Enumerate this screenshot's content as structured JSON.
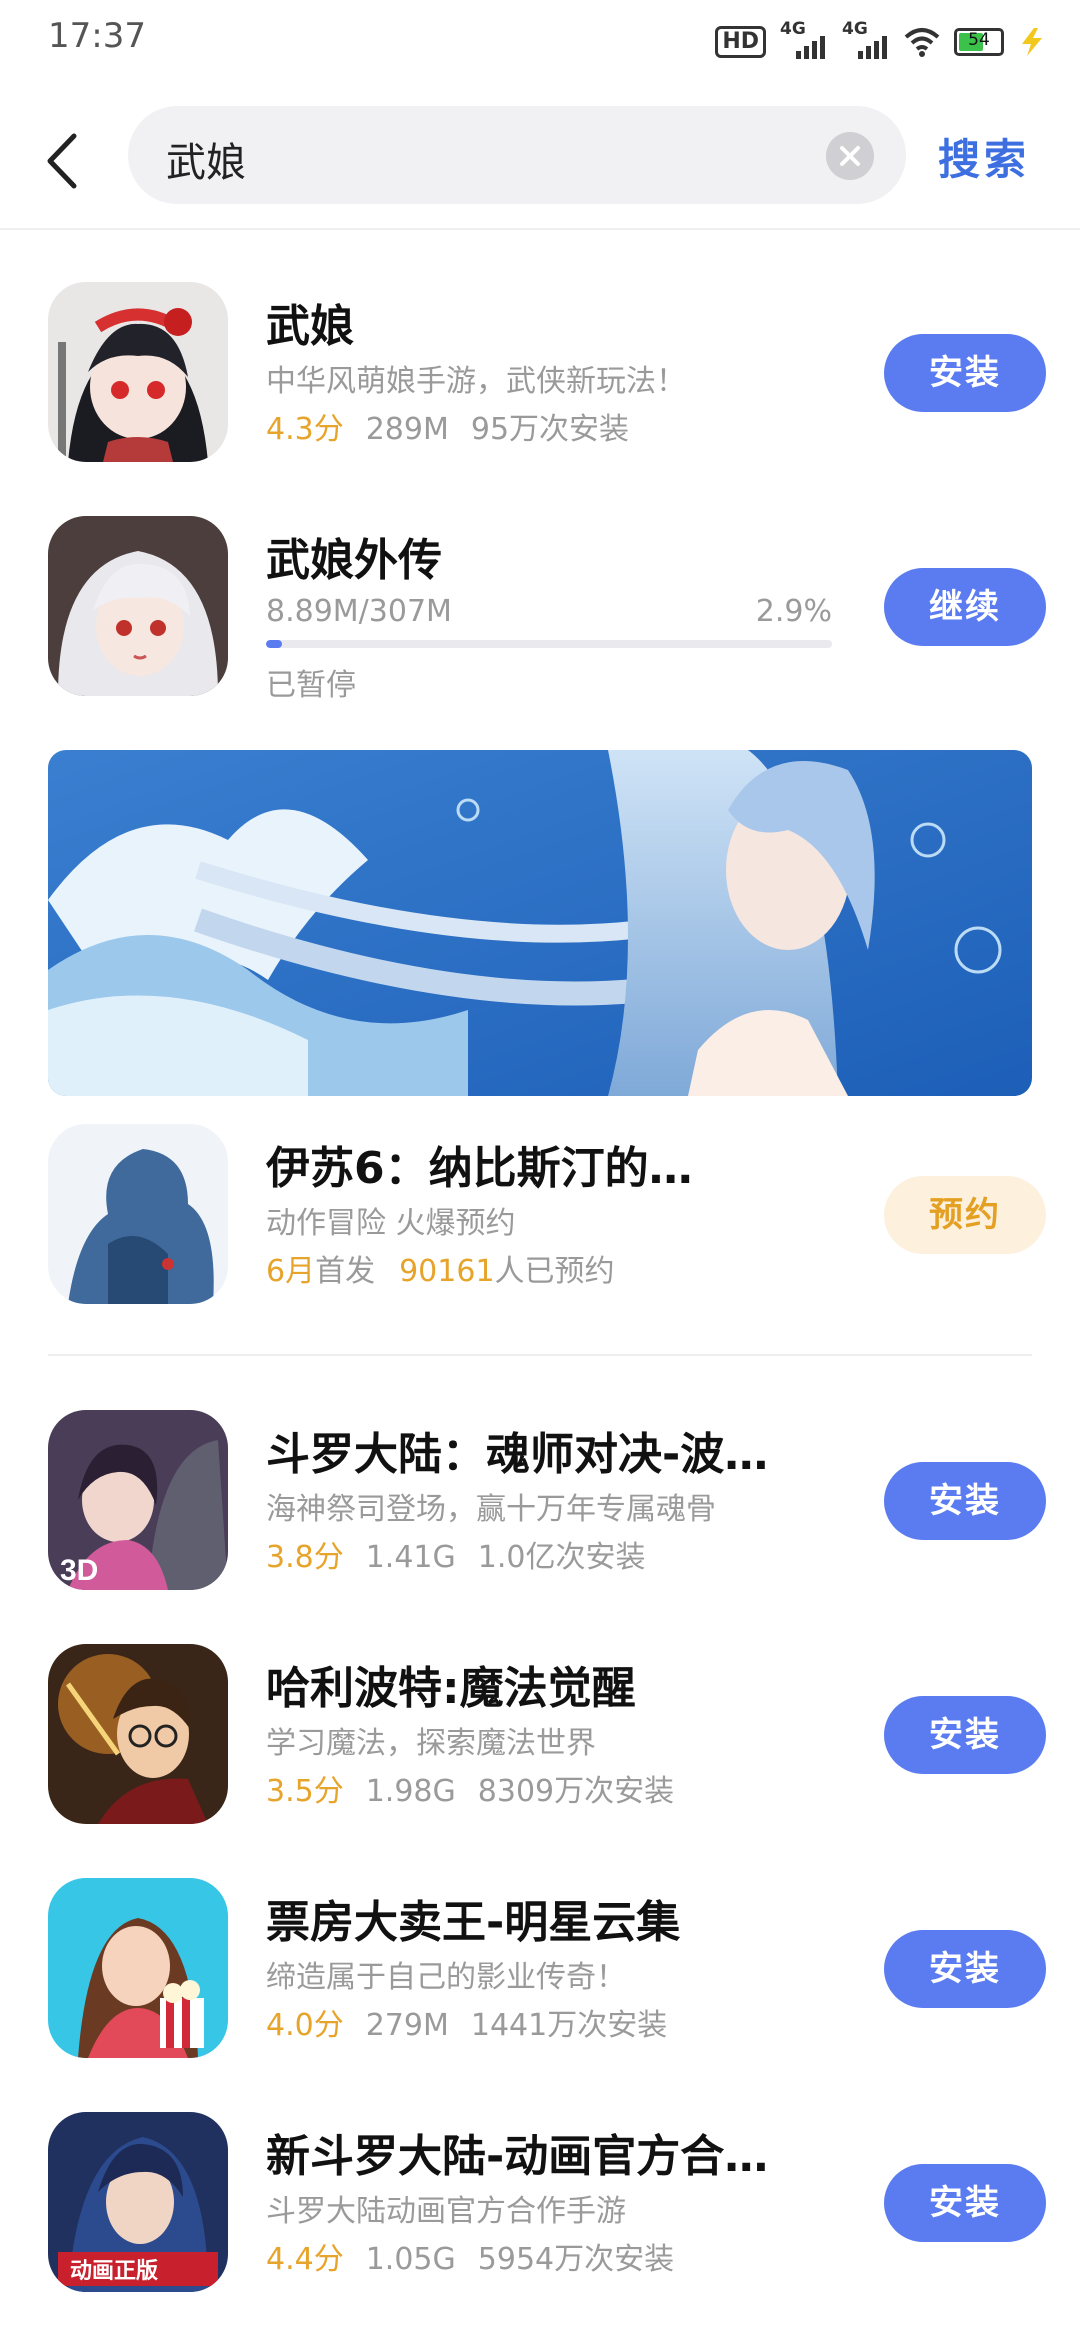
{
  "status_bar": {
    "time": "17:37",
    "net1": "4G",
    "net2": "4G",
    "battery": "54"
  },
  "search": {
    "query": "武娘",
    "button_label": "搜索"
  },
  "colors": {
    "accent": "#5b7cf0",
    "rating": "#e7a42b",
    "reserve_bg": "#fdf1de"
  },
  "apps": [
    {
      "name": "武娘",
      "desc": "中华风萌娘手游，武侠新玩法！",
      "rating": "4.3分",
      "size": "289M",
      "installs": "95万次安装",
      "action": "安装"
    }
  ],
  "downloading": {
    "name": "武娘外传",
    "progress_text": "8.89M/307M",
    "percent_text": "2.9%",
    "progress": 0.029,
    "status": "已暂停",
    "action": "继续"
  },
  "preorder": {
    "name": "伊苏6：纳比斯汀的…",
    "desc": "动作冒险  火爆预约",
    "month": "6月",
    "month_suffix": "首发",
    "count": "90161",
    "count_suffix": "人已预约",
    "action": "预约"
  },
  "more_apps": [
    {
      "name": "斗罗大陆：魂师对决-波…",
      "desc": "海神祭司登场，赢十万年专属魂骨",
      "rating": "3.8分",
      "size": "1.41G",
      "installs": "1.0亿次安装",
      "action": "安装"
    },
    {
      "name": "哈利波特:魔法觉醒",
      "desc": "学习魔法，探索魔法世界",
      "rating": "3.5分",
      "size": "1.98G",
      "installs": "8309万次安装",
      "action": "安装"
    },
    {
      "name": "票房大卖王-明星云集",
      "desc": "缔造属于自己的影业传奇！",
      "rating": "4.0分",
      "size": "279M",
      "installs": "1441万次安装",
      "action": "安装"
    },
    {
      "name": "新斗罗大陆-动画官方合…",
      "desc": "斗罗大陆动画官方合作手游",
      "rating": "4.4分",
      "size": "1.05G",
      "installs": "5954万次安装",
      "action": "安装"
    }
  ],
  "icons": {
    "back": "chevron-left-icon",
    "clear": "close-icon"
  }
}
